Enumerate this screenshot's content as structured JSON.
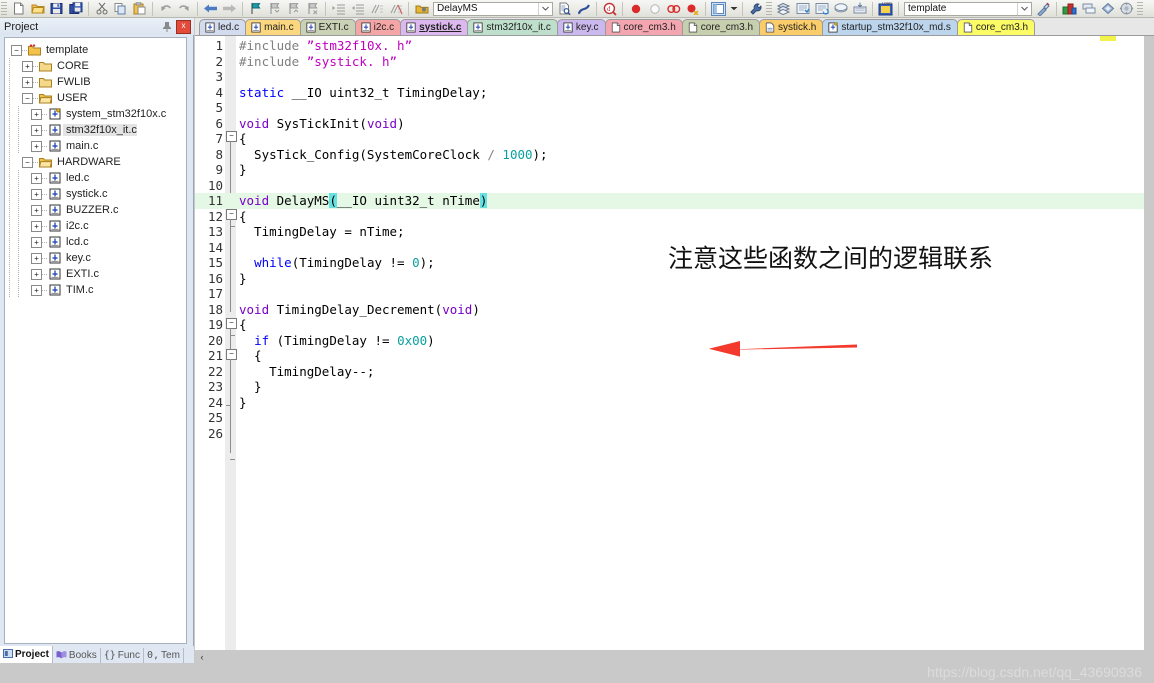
{
  "toolbar": {
    "groups": [
      {
        "icons": [
          "new-file-icon",
          "open-folder-icon",
          "save-icon",
          "save-all-icon"
        ]
      },
      {
        "icons": [
          "cut-icon",
          "copy-icon",
          "paste-icon"
        ]
      },
      {
        "icons": [
          "undo-icon",
          "redo-icon"
        ]
      },
      {
        "icons": [
          "navigate-back-icon",
          "navigate-forward-icon"
        ]
      },
      {
        "icons": [
          "bookmark-icon",
          "bookmark-next-icon",
          "bookmark-prev-icon",
          "bookmark-clear-icon"
        ]
      },
      {
        "icons": [
          "indent-icon",
          "outdent-icon",
          "comment-icon",
          "uncomment-icon"
        ]
      }
    ],
    "function_combo": {
      "value": "DelayMS",
      "placeholder": "DelayMS"
    },
    "after_combo_icons": [
      "find-in-files-icon",
      "bookmark-flag-icon"
    ],
    "debug_icons": [
      "find-icon"
    ],
    "breakpoint_icons": [
      "insert-breakpoint-icon",
      "disable-breakpoint-icon",
      "kill-all-breakpoints-icon",
      "disable-all-breakpoints-icon"
    ],
    "window_icons": [
      "window-layout-icon",
      "window-dropdown-icon"
    ],
    "config_icons": [
      "configure-target-icon"
    ],
    "build_icons": [
      "translate-icon",
      "build-icon",
      "rebuild-icon",
      "batch-build-icon",
      "download-icon",
      "load-icon"
    ],
    "target_combo": {
      "value": "template"
    },
    "right_icons": [
      "target-options-icon",
      "components-icon",
      "manage-project-icon",
      "multi-project-icon",
      "pack-installer-icon"
    ]
  },
  "project_panel": {
    "title": "Project",
    "pin_icon": "pin-icon",
    "close_label": "x",
    "tree": [
      {
        "label": "template",
        "level": 0,
        "icon": "project-icon",
        "expander": "-",
        "selected": false
      },
      {
        "label": "CORE",
        "level": 1,
        "icon": "folder-icon",
        "expander": "+",
        "selected": false
      },
      {
        "label": "FWLIB",
        "level": 1,
        "icon": "folder-icon",
        "expander": "+",
        "selected": false
      },
      {
        "label": "USER",
        "level": 1,
        "icon": "folder-open-icon",
        "expander": "-",
        "selected": false
      },
      {
        "label": "system_stm32f10x.c",
        "level": 2,
        "icon": "c-file-key-icon",
        "expander": "+",
        "selected": false
      },
      {
        "label": "stm32f10x_it.c",
        "level": 2,
        "icon": "c-file-icon",
        "expander": "+",
        "selected": true
      },
      {
        "label": "main.c",
        "level": 2,
        "icon": "c-file-icon",
        "expander": "+",
        "selected": false
      },
      {
        "label": "HARDWARE",
        "level": 1,
        "icon": "folder-open-icon",
        "expander": "-",
        "selected": false
      },
      {
        "label": "led.c",
        "level": 2,
        "icon": "c-file-icon",
        "expander": "+",
        "selected": false
      },
      {
        "label": "systick.c",
        "level": 2,
        "icon": "c-file-icon",
        "expander": "+",
        "selected": false
      },
      {
        "label": "BUZZER.c",
        "level": 2,
        "icon": "c-file-icon",
        "expander": "+",
        "selected": false
      },
      {
        "label": "i2c.c",
        "level": 2,
        "icon": "c-file-icon",
        "expander": "+",
        "selected": false
      },
      {
        "label": "lcd.c",
        "level": 2,
        "icon": "c-file-icon",
        "expander": "+",
        "selected": false
      },
      {
        "label": "key.c",
        "level": 2,
        "icon": "c-file-icon",
        "expander": "+",
        "selected": false
      },
      {
        "label": "EXTI.c",
        "level": 2,
        "icon": "c-file-icon",
        "expander": "+",
        "selected": false
      },
      {
        "label": "TIM.c",
        "level": 2,
        "icon": "c-file-icon",
        "expander": "+",
        "selected": false
      }
    ],
    "bottom_tabs": [
      {
        "label": "Project",
        "icon": "project-tab-icon",
        "active": true
      },
      {
        "label": "Books",
        "icon": "books-tab-icon",
        "active": false
      },
      {
        "label": "Func",
        "icon": "functions-tab-icon",
        "active": false
      },
      {
        "label": "Tem",
        "icon": "templates-tab-icon",
        "active": false
      }
    ]
  },
  "document_tabs": [
    {
      "label": "led.c",
      "color": "#d3dcef",
      "icon": "c-file-icon",
      "active": false
    },
    {
      "label": "main.c",
      "color": "#fbd77f",
      "icon": "c-file-icon",
      "active": false
    },
    {
      "label": "EXTI.c",
      "color": "#c9d2b4",
      "icon": "c-file-icon",
      "active": false
    },
    {
      "label": "i2c.c",
      "color": "#f4a6a6",
      "icon": "c-file-icon",
      "active": false
    },
    {
      "label": "systick.c",
      "color": "#ddb8ef",
      "icon": "c-file-icon",
      "active": true
    },
    {
      "label": "stm32f10x_it.c",
      "color": "#bedfcb",
      "icon": "c-file-icon",
      "active": false
    },
    {
      "label": "key.c",
      "color": "#cbb8ee",
      "icon": "c-file-icon",
      "active": false
    },
    {
      "label": "core_cm3.h",
      "color": "#f4a6b0",
      "icon": "h-file-icon",
      "active": false
    },
    {
      "label": "core_cm3.h",
      "color": "#c6cfae",
      "icon": "h-file-icon",
      "active": false
    },
    {
      "label": "systick.h",
      "color": "#fbcd6a",
      "icon": "h-file-icon",
      "active": false
    },
    {
      "label": "startup_stm32f10x_md.s",
      "color": "#bcd4ec",
      "icon": "asm-file-icon",
      "active": false
    },
    {
      "label": "core_cm3.h",
      "color": "#fbfb66",
      "icon": "h-file-icon",
      "active": false
    }
  ],
  "code": {
    "current_line": 11,
    "lines": [
      {
        "n": 1,
        "html": "<span class=\"prep\">#include</span> <span class=\"str\">”stm32f10x. h”</span>"
      },
      {
        "n": 2,
        "html": "<span class=\"prep\">#include</span> <span class=\"str\">”systick. h”</span>"
      },
      {
        "n": 3,
        "html": ""
      },
      {
        "n": 4,
        "html": "<span class=\"kw\">static</span> __IO uint32_t TimingDelay;"
      },
      {
        "n": 5,
        "html": ""
      },
      {
        "n": 6,
        "html": "<span class=\"kw2\">void</span> SysTickInit(<span class=\"kw2\">void</span>)"
      },
      {
        "n": 7,
        "html": "{"
      },
      {
        "n": 8,
        "html": "  SysTick_Config(SystemCoreClock <span class=\"pp\">/</span> <span class=\"num2\">1000</span>);"
      },
      {
        "n": 9,
        "html": "}"
      },
      {
        "n": 10,
        "html": ""
      },
      {
        "n": 11,
        "html": "<span class=\"kw2\">void</span> DelayMS<span class=\"hl\">(</span>__IO uint32_t nTime<span class=\"hl\">)</span>"
      },
      {
        "n": 12,
        "html": "{"
      },
      {
        "n": 13,
        "html": "  TimingDelay = nTime;"
      },
      {
        "n": 14,
        "html": ""
      },
      {
        "n": 15,
        "html": "  <span class=\"kw\">while</span>(TimingDelay != <span class=\"num2\">0</span>);"
      },
      {
        "n": 16,
        "html": "}"
      },
      {
        "n": 17,
        "html": ""
      },
      {
        "n": 18,
        "html": "<span class=\"kw2\">void</span> TimingDelay_Decrement(<span class=\"kw2\">void</span>)"
      },
      {
        "n": 19,
        "html": "{"
      },
      {
        "n": 20,
        "html": "  <span class=\"kw\">if</span> (TimingDelay != <span class=\"num2\">0x00</span>)"
      },
      {
        "n": 21,
        "html": "  {"
      },
      {
        "n": 22,
        "html": "    TimingDelay--;"
      },
      {
        "n": 23,
        "html": "  }"
      },
      {
        "n": 24,
        "html": "}"
      },
      {
        "n": 25,
        "html": ""
      },
      {
        "n": 26,
        "html": ""
      }
    ]
  },
  "annotation": {
    "text": "注意这些函数之间的逻辑联系",
    "arrow": {
      "name": "red-left-arrow",
      "color": "#f43a2c"
    }
  },
  "watermark": {
    "text": "https://blog.csdn.net/qq_43690936"
  },
  "scrollbar": {
    "left_arrow": "‹"
  }
}
